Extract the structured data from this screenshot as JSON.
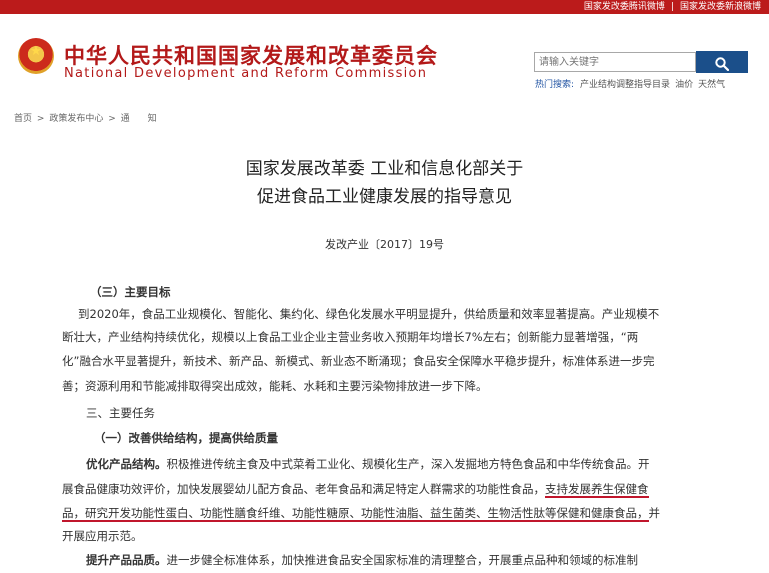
{
  "top_links": [
    "国家发改委腾讯微博",
    "国家发改委新浪微博"
  ],
  "top_sep": "|",
  "header": {
    "title_cn": "中华人民共和国国家发展和改革委员会",
    "title_en": "National Development and Reform Commission",
    "emblem_icon": "national-emblem-icon"
  },
  "search": {
    "placeholder": "请输入关键字",
    "button_icon": "search-icon",
    "hot_label": "热门搜索:",
    "hot_items": [
      "产业结构调整指导目录",
      "油价",
      "天然气"
    ]
  },
  "breadcrumb": {
    "items": [
      "首页",
      "政策发布中心",
      "通　　知"
    ],
    "separator": ">"
  },
  "document": {
    "title_line1": "国家发展改革委  工业和信息化部关于",
    "title_line2": "促进食品工业健康发展的指导意见",
    "doc_number": "发改产业〔2017〕19号",
    "section_goal_heading": "（三）主要目标",
    "goal_lines": [
      "到2020年，食品工业规模化、智能化、集约化、绿色化发展水平明显提升，供给质量和效率显著提高。产业规模不",
      "断壮大，产业结构持续优化，规模以上食品工业企业主营业务收入预期年均增长7%左右；创新能力显著增强，“两",
      "化”融合水平显著提升，新技术、新产品、新模式、新业态不断涌现；食品安全保障水平稳步提升，标准体系进一步完",
      "善；资源利用和节能减排取得突出成效，能耗、水耗和主要污染物排放进一步下降。"
    ],
    "tasks_heading": "三、主要任务",
    "subsection_heading": "（一）改善供给结构，提高供给质量",
    "optimize_label": "优化产品结构。",
    "optimize_line1": "积极推进传统主食及中式菜肴工业化、规模化生产，深入发掘地方特色食品和中华传统食品。开",
    "optimize_line2_plain": "展食品健康功效评价，加快发展婴幼儿配方食品、老年食品和满足特定人群需求的功能性食品，",
    "optimize_line2_ul": "支持发展养生保健食",
    "optimize_line3_ul": "品，研究开发功能性蛋白、功能性膳食纤维、功能性糖原、功能性油脂、益生菌类、生物活性肽等保健和健康食品，",
    "optimize_line3_plain": "并",
    "optimize_line4": "开展应用示范。",
    "quality_label": "提升产品品质。",
    "quality_line1": "进一步健全标准体系，加快推进食品安全国家标准的清理整合，开展重点品种和领域的标准制"
  },
  "colors": {
    "topbar": "#bb1b1b",
    "brand_red": "#b31919",
    "search_button": "#1b4f8a",
    "underline": "#b3132a"
  }
}
